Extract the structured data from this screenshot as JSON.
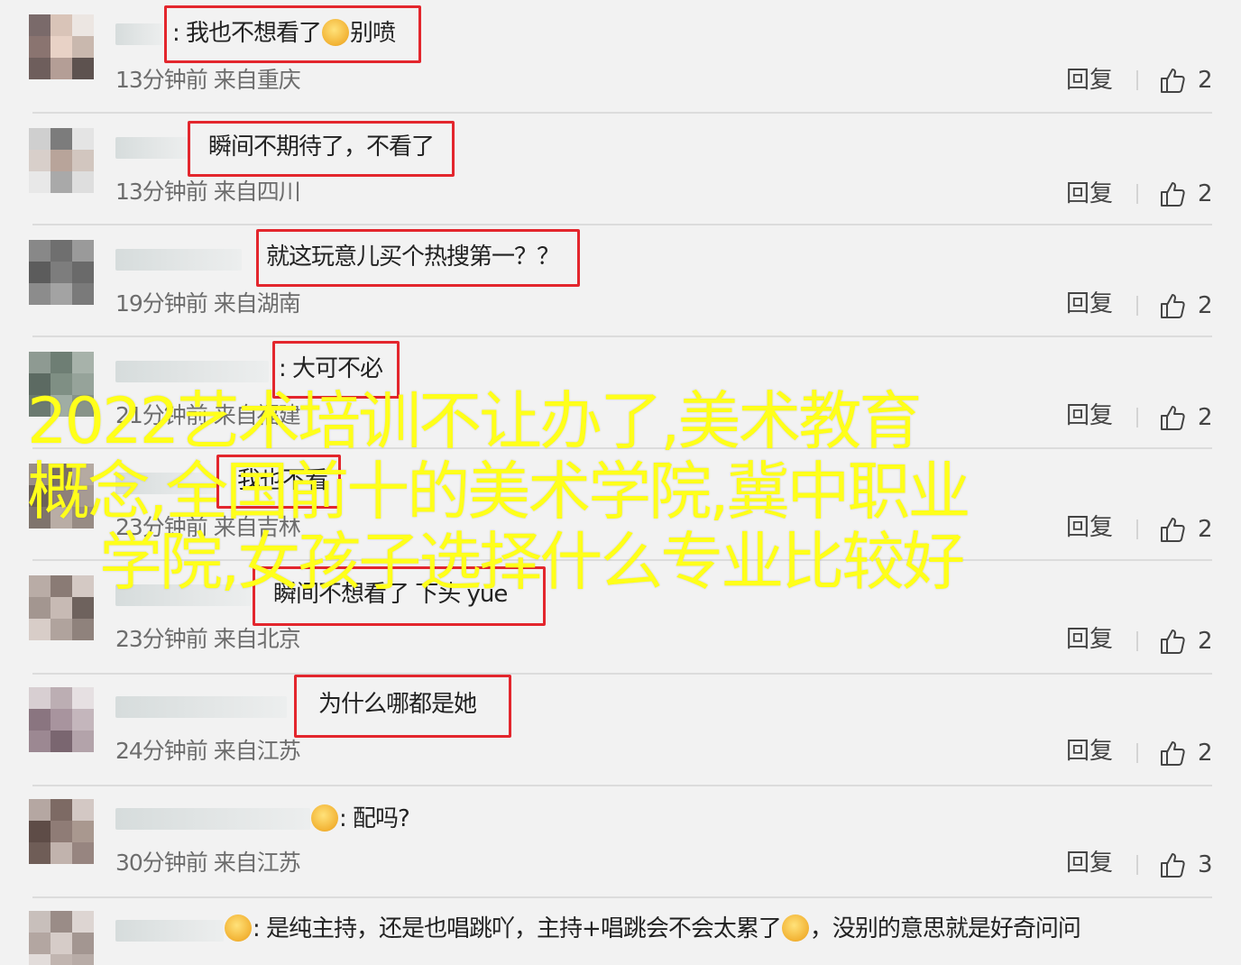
{
  "comments": [
    {
      "text": "我也不想看了",
      "emoji_after": "laugh-cry-emoji",
      "text_after": "别喷",
      "meta": "13分钟前 来自重庆",
      "reply": "回复",
      "likes": "2"
    },
    {
      "text": "瞬间不期待了，不看了",
      "meta": "13分钟前 来自四川",
      "reply": "回复",
      "likes": "2"
    },
    {
      "text": "就这玩意儿买个热搜第一？？",
      "meta": "19分钟前 来自湖南",
      "reply": "回复",
      "likes": "2"
    },
    {
      "text": "大可不必",
      "meta": "21分钟前 来自福建",
      "reply": "回复",
      "likes": "2"
    },
    {
      "text": "我也不看",
      "meta": "23分钟前 来自吉林",
      "reply": "回复",
      "likes": "2"
    },
    {
      "text": "瞬间不想看了 下头 yue",
      "meta": "23分钟前 来自北京",
      "reply": "回复",
      "likes": "2"
    },
    {
      "text": "为什么哪都是她",
      "meta": "24分钟前 来自江苏",
      "reply": "回复",
      "likes": "2"
    },
    {
      "text": "配吗?",
      "meta": "30分钟前 来自江苏",
      "reply": "回复",
      "likes": "3"
    },
    {
      "text": "是纯主持，还是也唱跳吖，主持+唱跳会不会太累了",
      "text_after": "，没别的意思就是好奇问问",
      "meta": "",
      "reply": "",
      "likes": ""
    }
  ],
  "overlay": {
    "line1": "2022艺术培训不让办了,美术教育",
    "line2": "概念,全国前十的美术学院,冀中职业",
    "line3": "学院,女孩子选择什么专业比较好"
  },
  "colors": {
    "highlight_box": "#e3262d",
    "overlay_text": "#ffff1a",
    "background": "#f2f2f2"
  }
}
